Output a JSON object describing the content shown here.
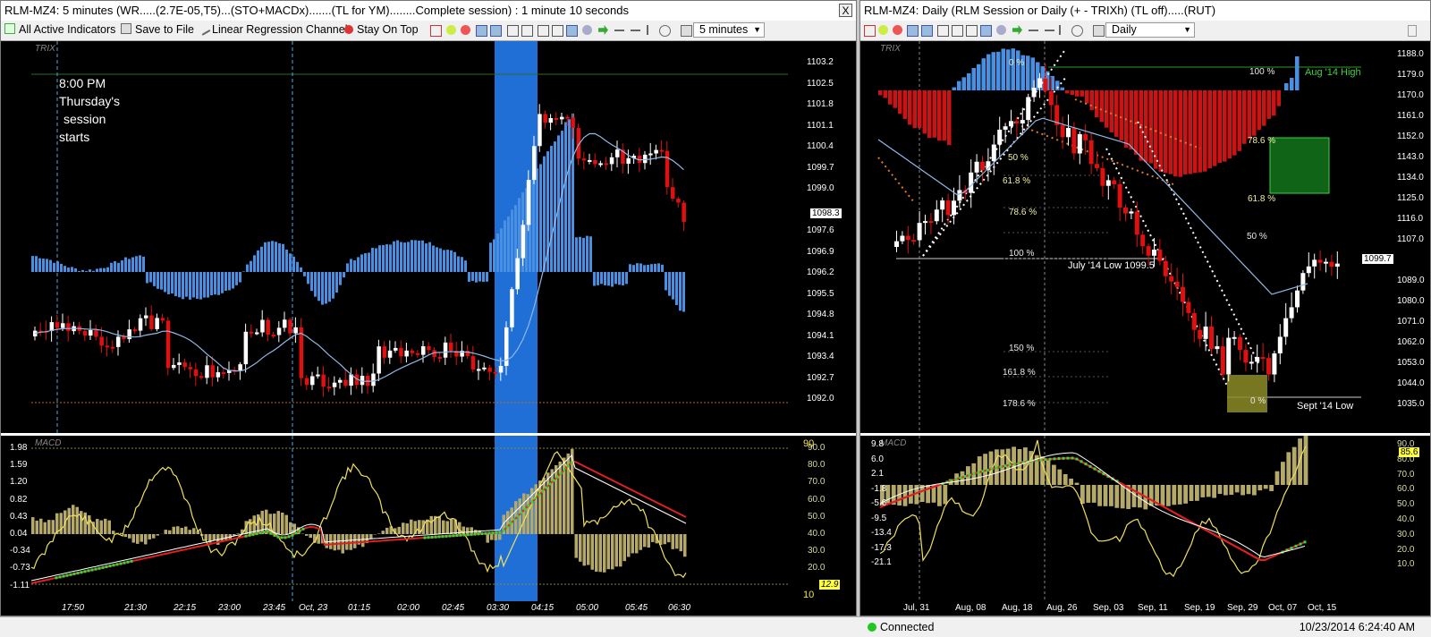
{
  "left_window": {
    "title": "RLM-MZ4: 5 minutes (WR.....(2.7E-05,T5)...(STO+MACDx).......(TL for YM)........Complete session) : 1 minute 10 seconds",
    "close_label": "X",
    "toolbar": {
      "all_indicators": "All Active Indicators",
      "save_to_file": "Save to File",
      "linear_regression": "Linear Regression Channel",
      "stay_on_top": "Stay On Top",
      "interval": "5 minutes"
    },
    "price_pane": {
      "label": "TRIX",
      "last_price": "1098.3",
      "y_labels": [
        "1103.2",
        "1102.5",
        "1101.8",
        "1101.1",
        "1100.4",
        "1099.7",
        "1099.0",
        "1097.6",
        "1096.9",
        "1096.2",
        "1095.5",
        "1094.8",
        "1094.1",
        "1093.4",
        "1092.7",
        "1092.0"
      ],
      "annotation": [
        "8:00 PM",
        "Thursday's",
        "session",
        "starts"
      ]
    },
    "macd_pane": {
      "label": "MACD",
      "left_labels": [
        "1.98",
        "1.59",
        "1.20",
        "0.82",
        "0.43",
        "0.04",
        "-0.34",
        "-0.73",
        "-1.11"
      ],
      "right_labels": [
        "90.0",
        "80.0",
        "70.0",
        "60.0",
        "50.0",
        "40.0",
        "30.0",
        "20.0"
      ],
      "level_high": "90",
      "level_low": "10",
      "stoch_value": "12.9"
    },
    "x_labels": [
      "17:50",
      "21:30",
      "22:15",
      "23:00",
      "23:45",
      "Oct, 23",
      "01:15",
      "02:00",
      "02:45",
      "03:30",
      "04:15",
      "05:00",
      "05:45",
      "06:30"
    ]
  },
  "right_window": {
    "title": "RLM-MZ4: Daily (RLM  Session or Daily (+ - TRIXh) (TL off).....(RUT)",
    "interval": "Daily",
    "price_pane": {
      "label": "TRIX",
      "last_price": "1099.7",
      "y_labels": [
        "1188.0",
        "1179.0",
        "1170.0",
        "1161.0",
        "1152.0",
        "1143.0",
        "1134.0",
        "1125.0",
        "1116.0",
        "1107.0",
        "1089.0",
        "1080.0",
        "1071.0",
        "1062.0",
        "1053.0",
        "1044.0",
        "1035.0"
      ],
      "fib_left": [
        "0 %",
        "50 %",
        "61.8 %",
        "78.6 %",
        "100 %",
        "150 %",
        "161.8 %",
        "178.6 %"
      ],
      "fib_right": [
        "100 %",
        "78.6 %",
        "61.8 %",
        "50 %",
        "0 %"
      ],
      "annotations": {
        "aug_high": "Aug '14 High",
        "july_low": "July '14 Low 1099.5",
        "sept_low": "Sept '14 Low"
      }
    },
    "macd_pane": {
      "label": "MACD",
      "left_labels": [
        "9.8",
        "6.0",
        "2.1",
        "-1.8",
        "-5.6",
        "-9.5",
        "-13.4",
        "-17.3",
        "-21.1"
      ],
      "right_labels": [
        "90.0",
        "80.0",
        "70.0",
        "60.0",
        "50.0",
        "40.0",
        "30.0",
        "20.0",
        "10.0"
      ],
      "stoch_value": "85.6"
    },
    "x_labels": [
      "Jul, 31",
      "Aug, 08",
      "Aug, 18",
      "Aug, 26",
      "Sep, 03",
      "Sep, 11",
      "Sep, 19",
      "Sep, 29",
      "Oct, 07",
      "Oct, 15"
    ]
  },
  "status_bar": {
    "connection": "Connected",
    "timestamp": "10/23/2014 6:24:40 AM"
  },
  "colors": {
    "bull": "#ffffff",
    "bear": "#e01010",
    "trix_up": "#4a90e2",
    "trix_down": "#c81414",
    "macd_hist": "#b5a96a",
    "highlight_band": "#1f6fd6",
    "target_box": "#0f6418",
    "stoch": "#f0e060"
  }
}
